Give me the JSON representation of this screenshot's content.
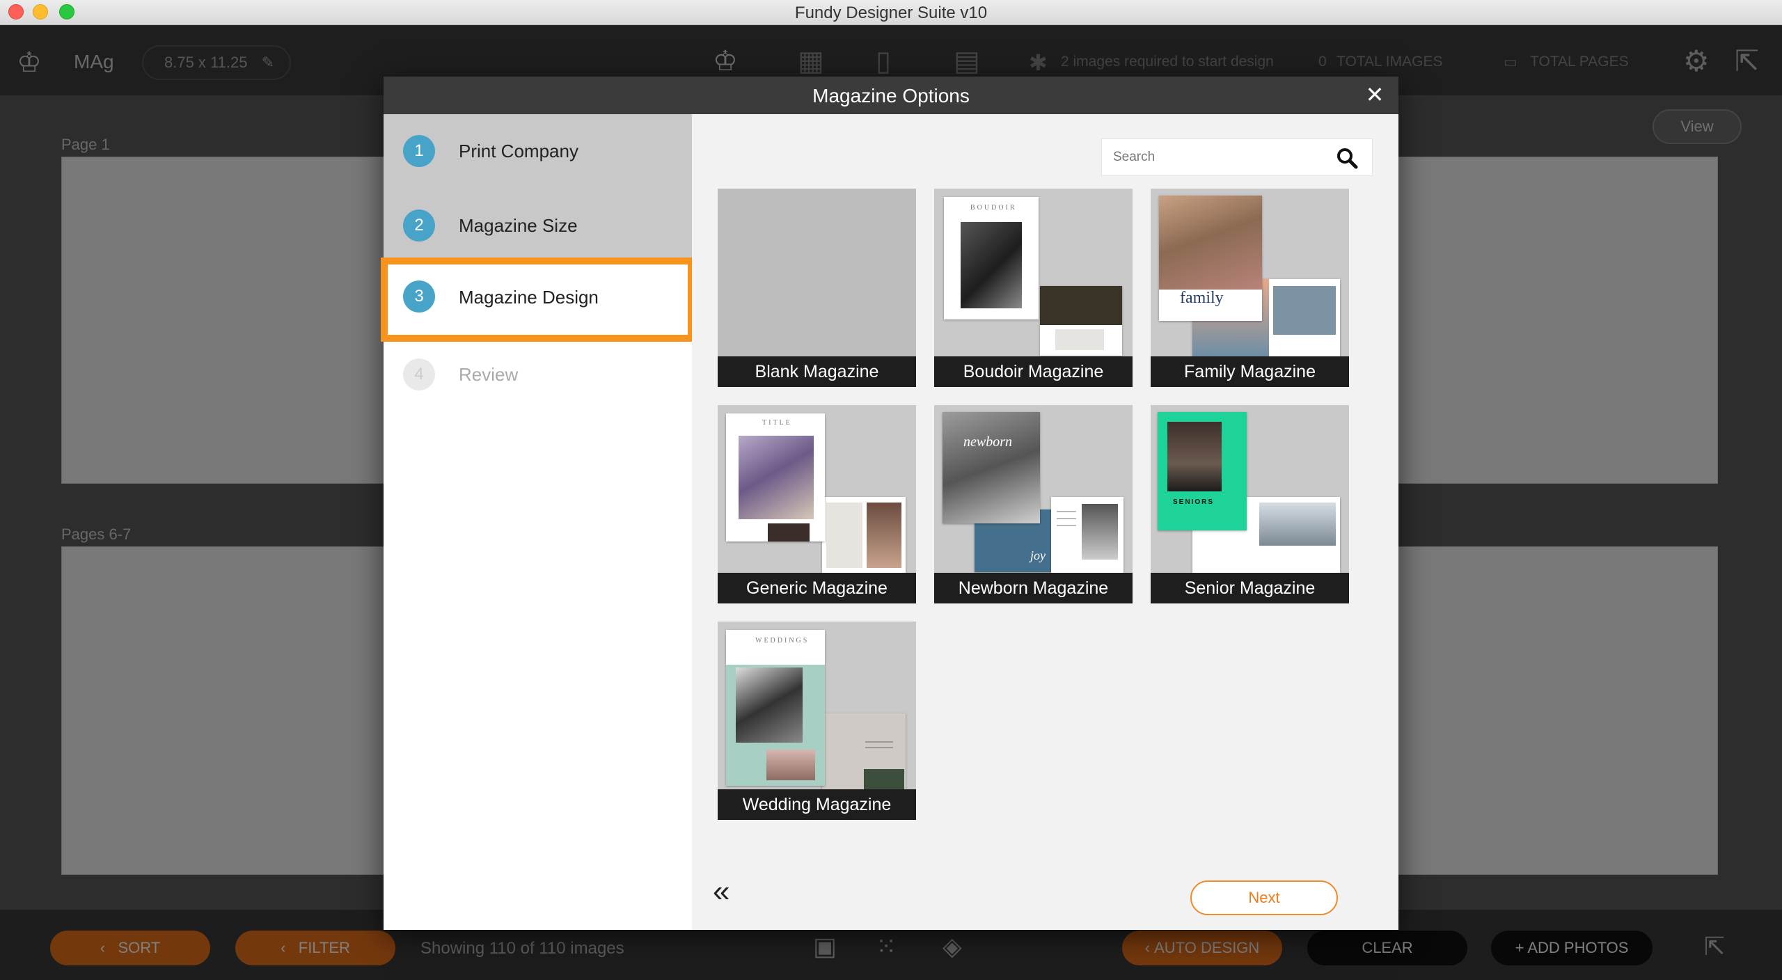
{
  "window": {
    "title": "Fundy Designer Suite v10"
  },
  "toolbar": {
    "project_name": "MAg",
    "size_label": "8.75 x 11.25",
    "images_required": "2 images required to start design",
    "total_images_count": "0",
    "total_images_label": "TOTAL IMAGES",
    "total_pages_label": "TOTAL PAGES",
    "view_label": "View"
  },
  "workspace": {
    "page1_label": "Page 1",
    "pages67_label": "Pages 6-7"
  },
  "bottombar": {
    "sort_label": "SORT",
    "filter_label": "FILTER",
    "showing_text": "Showing 110 of 110 images",
    "auto_design_label": "AUTO DESIGN",
    "clear_label": "CLEAR",
    "add_photos_label": "+ ADD PHOTOS"
  },
  "modal": {
    "title": "Magazine Options",
    "close_glyph": "✕",
    "steps": [
      {
        "num": "1",
        "label": "Print Company",
        "state": "done"
      },
      {
        "num": "2",
        "label": "Magazine Size",
        "state": "done"
      },
      {
        "num": "3",
        "label": "Magazine Design",
        "state": "current"
      },
      {
        "num": "4",
        "label": "Review",
        "state": "pending"
      }
    ],
    "search_placeholder": "Search",
    "designs": [
      {
        "label": "Blank Magazine"
      },
      {
        "label": "Boudoir Magazine",
        "mini_title": "BOUDOIR"
      },
      {
        "label": "Family Magazine",
        "mini_title": "family"
      },
      {
        "label": "Generic Magazine",
        "mini_title": "TITLE"
      },
      {
        "label": "Newborn Magazine",
        "mini_title": "newborn",
        "accent": "joy"
      },
      {
        "label": "Senior Magazine",
        "mini_title": "SENIORS"
      },
      {
        "label": "Wedding Magazine",
        "mini_title": "WEDDINGS"
      }
    ],
    "back_glyph": "«",
    "next_label": "Next"
  },
  "colors": {
    "accent_orange": "#f7941d",
    "step_blue": "#47a3c8",
    "header_dark": "#3b3b3b"
  }
}
